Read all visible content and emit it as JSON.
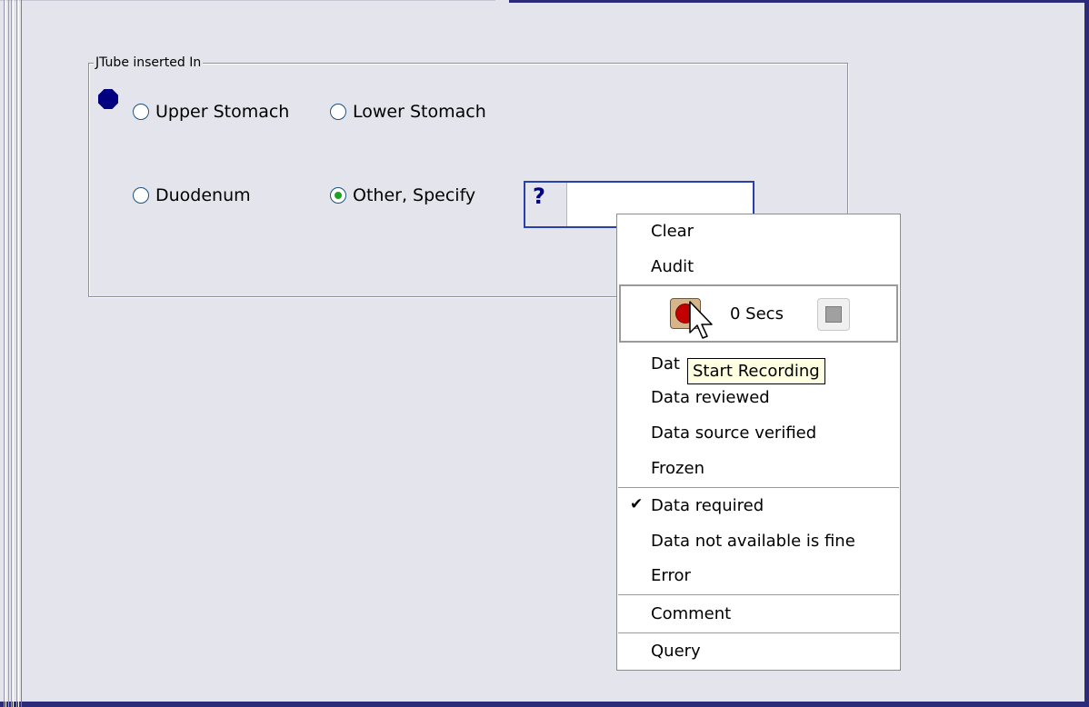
{
  "group": {
    "title": "JTube inserted In",
    "options": [
      {
        "label": "Upper Stomach",
        "checked": false
      },
      {
        "label": "Lower Stomach",
        "checked": false
      },
      {
        "label": "Duodenum",
        "checked": false
      },
      {
        "label": "Other, Specify",
        "checked": true
      }
    ],
    "specify": {
      "icon_text": "?",
      "value": ""
    }
  },
  "menu": {
    "items_top": [
      "Clear",
      "Audit"
    ],
    "recorder": {
      "seconds": "0 Secs",
      "record_icon": "record-icon",
      "stop_icon": "stop-icon"
    },
    "items_data": [
      "Data reviewed",
      "Data source verified",
      "Frozen"
    ],
    "items_required": [
      "Data required",
      "Data not available is fine",
      "Error"
    ],
    "checked_item": "Data required",
    "comment": "Comment",
    "query": "Query"
  },
  "tooltip": {
    "text": "Start Recording"
  },
  "colors": {
    "background": "#e4e4ec",
    "frame_blue": "#2b2b7a",
    "required_dot": "#000080",
    "record_red": "#c30000",
    "tooltip_bg": "#ffffe1"
  }
}
